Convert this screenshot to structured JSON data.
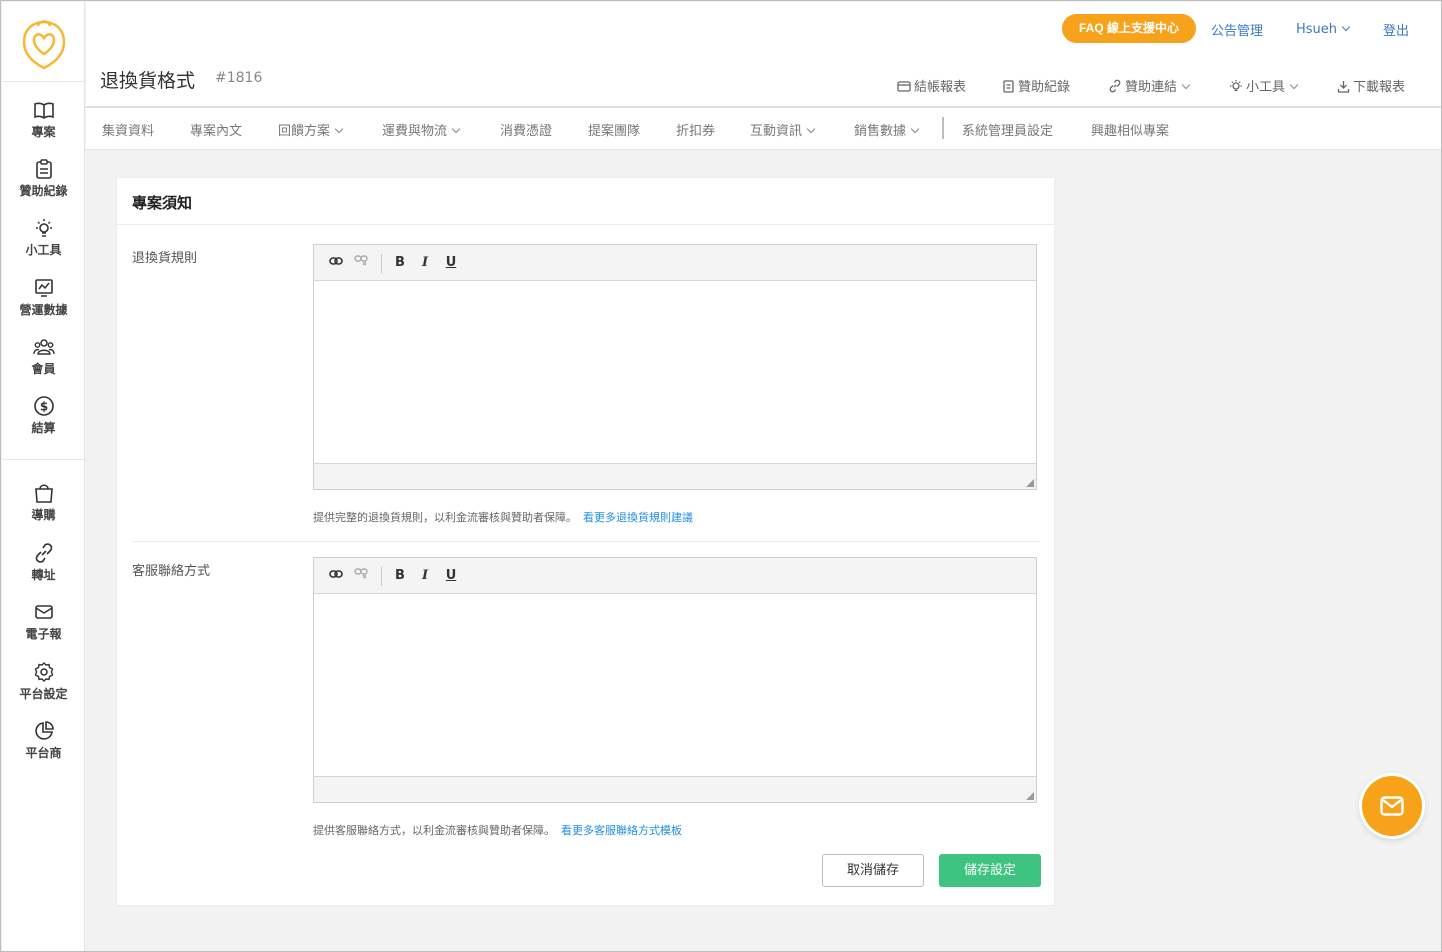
{
  "sidebar": {
    "items": [
      {
        "label": "專案",
        "icon": "book-icon"
      },
      {
        "label": "贊助紀錄",
        "icon": "clipboard-icon"
      },
      {
        "label": "小工具",
        "icon": "lightbulb-icon"
      },
      {
        "label": "營運數據",
        "icon": "chart-icon"
      },
      {
        "label": "會員",
        "icon": "members-icon"
      },
      {
        "label": "結算",
        "icon": "dollar-icon"
      },
      {
        "label": "導購",
        "icon": "shopping-bag-icon"
      },
      {
        "label": "轉址",
        "icon": "link-icon"
      },
      {
        "label": "電子報",
        "icon": "mail-icon"
      },
      {
        "label": "平台設定",
        "icon": "gear-icon"
      },
      {
        "label": "平台商",
        "icon": "pie-icon"
      }
    ]
  },
  "header": {
    "faq_label": "FAQ 線上支援中心",
    "announcement_label": "公告管理",
    "user_label": "Hsueh",
    "logout_label": "登出",
    "title": "退換貨格式",
    "project_id": "#1816",
    "actions": {
      "billing": "結帳報表",
      "sponsor_records": "贊助紀錄",
      "sponsor_link": "贊助連結",
      "tools": "小工具",
      "download": "下載報表"
    }
  },
  "tabs": [
    {
      "label": "集資資料",
      "dropdown": false
    },
    {
      "label": "專案內文",
      "dropdown": false
    },
    {
      "label": "回饋方案",
      "dropdown": true
    },
    {
      "label": "運費與物流",
      "dropdown": true
    },
    {
      "label": "消費憑證",
      "dropdown": false
    },
    {
      "label": "提案團隊",
      "dropdown": false
    },
    {
      "label": "折扣券",
      "dropdown": false
    },
    {
      "label": "互動資訊",
      "dropdown": true
    },
    {
      "label": "銷售數據",
      "dropdown": true
    },
    {
      "label": "系統管理員設定",
      "dropdown": false
    },
    {
      "label": "興趣相似專案",
      "dropdown": false
    }
  ],
  "card": {
    "title": "專案須知",
    "fields": [
      {
        "label": "退換貨規則",
        "value": "",
        "hint": "提供完整的退換貨規則，以利金流審核與贊助者保障。",
        "hint_link": "看更多退換貨規則建議"
      },
      {
        "label": "客服聯絡方式",
        "value": "",
        "hint": "提供客服聯絡方式，以利金流審核與贊助者保障。",
        "hint_link": "看更多客服聯絡方式模板"
      }
    ],
    "toolbar": {
      "bold": "B",
      "italic": "I",
      "underline": "U"
    },
    "cancel_label": "取消儲存",
    "save_label": "儲存設定"
  },
  "colors": {
    "accent": "#f7a21b",
    "link": "#3a78c4",
    "save": "#3fc380"
  }
}
